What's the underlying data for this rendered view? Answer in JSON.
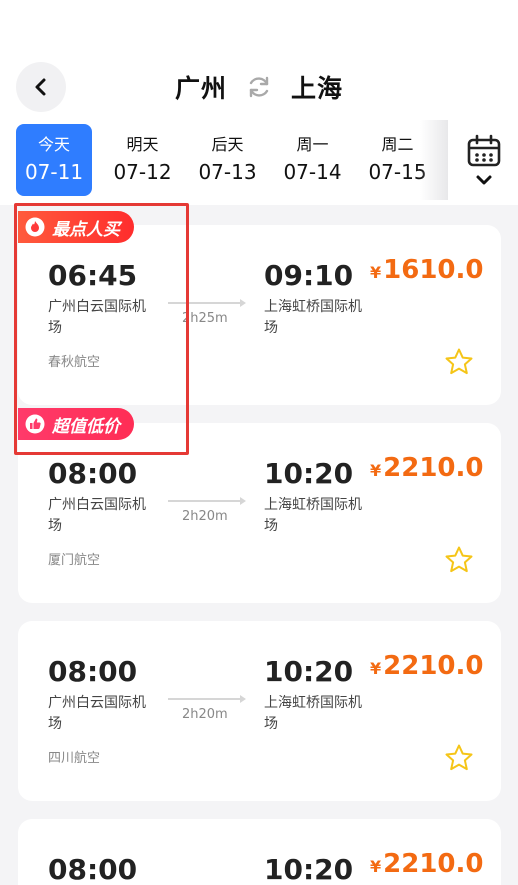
{
  "header": {
    "from_city": "广州",
    "to_city": "上海"
  },
  "dates": [
    {
      "dow": "今天",
      "md": "07-11",
      "active": true
    },
    {
      "dow": "明天",
      "md": "07-12",
      "active": false
    },
    {
      "dow": "后天",
      "md": "07-13",
      "active": false
    },
    {
      "dow": "周一",
      "md": "07-14",
      "active": false
    },
    {
      "dow": "周二",
      "md": "07-15",
      "active": false
    }
  ],
  "badges": {
    "most_bought": "最点人买",
    "value_low_price": "超值低价"
  },
  "flights": [
    {
      "dep_time": "06:45",
      "dep_airport": "广州白云国际机场",
      "arr_time": "09:10",
      "arr_airport": "上海虹桥国际机场",
      "duration": "2h25m",
      "airline": "春秋航空",
      "currency": "¥",
      "price": "1610.0"
    },
    {
      "dep_time": "08:00",
      "dep_airport": "广州白云国际机场",
      "arr_time": "10:20",
      "arr_airport": "上海虹桥国际机场",
      "duration": "2h20m",
      "airline": "厦门航空",
      "currency": "¥",
      "price": "2210.0"
    },
    {
      "dep_time": "08:00",
      "dep_airport": "广州白云国际机场",
      "arr_time": "10:20",
      "arr_airport": "上海虹桥国际机场",
      "duration": "2h20m",
      "airline": "四川航空",
      "currency": "¥",
      "price": "2210.0"
    },
    {
      "dep_time": "08:00",
      "arr_time": "10:20",
      "currency": "¥",
      "price": "2210.0"
    }
  ],
  "colors": {
    "accent": "#2f7dff",
    "price": "#f36a12",
    "badge": "#ff3a3a",
    "star": "#f5c518"
  }
}
